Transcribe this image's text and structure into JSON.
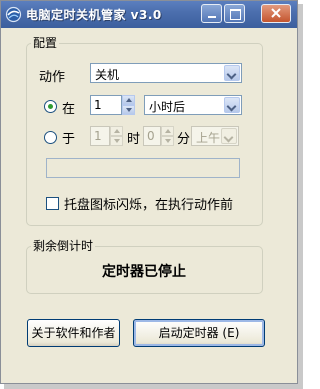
{
  "window": {
    "title": "电脑定时关机管家 v3.0"
  },
  "config": {
    "group_label": "配置",
    "action_label": "动作",
    "action_value": "关机",
    "in_label": "在",
    "in_value": "1",
    "in_unit": "小时后",
    "at_label": "于",
    "at_hour": "1",
    "hour_label": "时",
    "at_minute": "0",
    "minute_label": "分",
    "ampm": "上午",
    "tray_blink_label": "托盘图标闪烁，在执行动作前"
  },
  "countdown": {
    "group_label": "剩余倒计时",
    "status": "定时器已停止"
  },
  "buttons": {
    "about": "关于软件和作者",
    "start": "启动定时器 (E)"
  },
  "colors": {
    "title_bar": "#4c6fae",
    "window_bg": "#ece9d8",
    "radio_dot": "#2f9a2f"
  }
}
